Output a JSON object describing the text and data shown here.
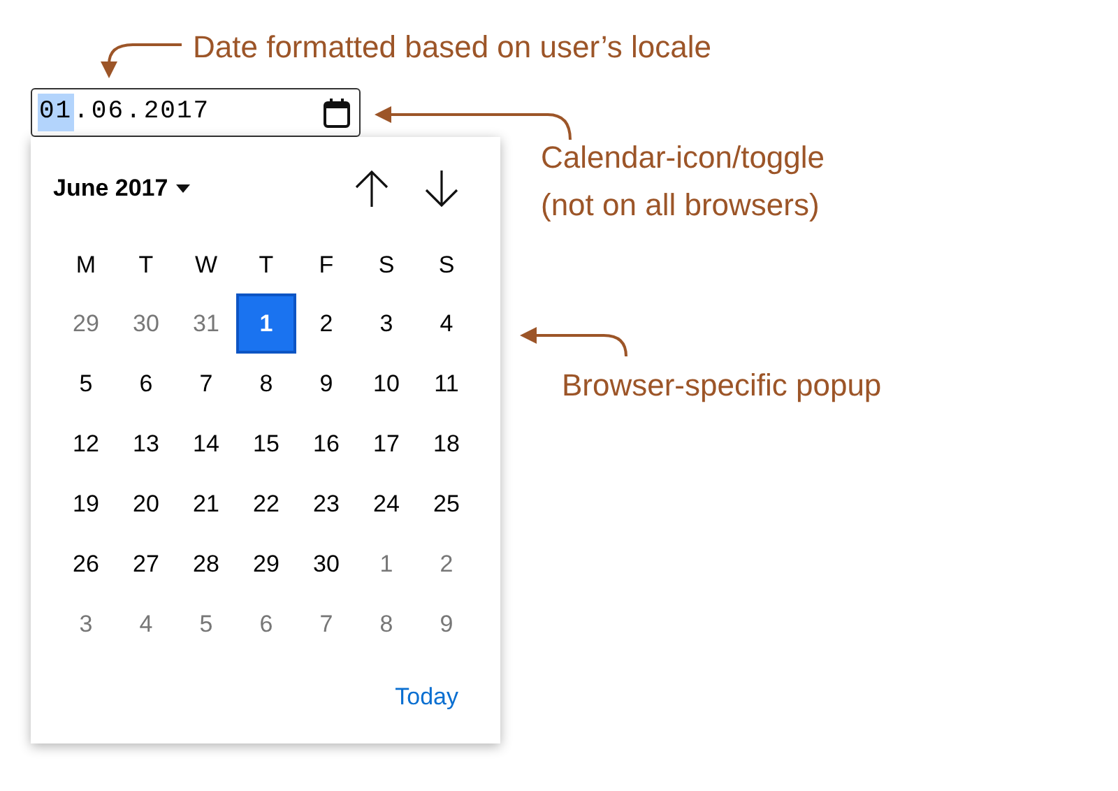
{
  "date_field": {
    "segments": [
      {
        "kind": "part",
        "text": "01",
        "selected": true
      },
      {
        "kind": "separator",
        "text": "."
      },
      {
        "kind": "part",
        "text": "06",
        "selected": false
      },
      {
        "kind": "separator",
        "text": "."
      },
      {
        "kind": "part",
        "text": "2017",
        "selected": false
      }
    ]
  },
  "calendar": {
    "title": "June 2017",
    "weekdays": [
      "M",
      "T",
      "W",
      "T",
      "F",
      "S",
      "S"
    ],
    "weeks": [
      [
        {
          "text": "29",
          "muted": true,
          "selected": false
        },
        {
          "text": "30",
          "muted": true,
          "selected": false
        },
        {
          "text": "31",
          "muted": true,
          "selected": false
        },
        {
          "text": "1",
          "muted": false,
          "selected": true
        },
        {
          "text": "2",
          "muted": false,
          "selected": false
        },
        {
          "text": "3",
          "muted": false,
          "selected": false
        },
        {
          "text": "4",
          "muted": false,
          "selected": false
        }
      ],
      [
        {
          "text": "5",
          "muted": false,
          "selected": false
        },
        {
          "text": "6",
          "muted": false,
          "selected": false
        },
        {
          "text": "7",
          "muted": false,
          "selected": false
        },
        {
          "text": "8",
          "muted": false,
          "selected": false
        },
        {
          "text": "9",
          "muted": false,
          "selected": false
        },
        {
          "text": "10",
          "muted": false,
          "selected": false
        },
        {
          "text": "11",
          "muted": false,
          "selected": false
        }
      ],
      [
        {
          "text": "12",
          "muted": false,
          "selected": false
        },
        {
          "text": "13",
          "muted": false,
          "selected": false
        },
        {
          "text": "14",
          "muted": false,
          "selected": false
        },
        {
          "text": "15",
          "muted": false,
          "selected": false
        },
        {
          "text": "16",
          "muted": false,
          "selected": false
        },
        {
          "text": "17",
          "muted": false,
          "selected": false
        },
        {
          "text": "18",
          "muted": false,
          "selected": false
        }
      ],
      [
        {
          "text": "19",
          "muted": false,
          "selected": false
        },
        {
          "text": "20",
          "muted": false,
          "selected": false
        },
        {
          "text": "21",
          "muted": false,
          "selected": false
        },
        {
          "text": "22",
          "muted": false,
          "selected": false
        },
        {
          "text": "23",
          "muted": false,
          "selected": false
        },
        {
          "text": "24",
          "muted": false,
          "selected": false
        },
        {
          "text": "25",
          "muted": false,
          "selected": false
        }
      ],
      [
        {
          "text": "26",
          "muted": false,
          "selected": false
        },
        {
          "text": "27",
          "muted": false,
          "selected": false
        },
        {
          "text": "28",
          "muted": false,
          "selected": false
        },
        {
          "text": "29",
          "muted": false,
          "selected": false
        },
        {
          "text": "30",
          "muted": false,
          "selected": false
        },
        {
          "text": "1",
          "muted": true,
          "selected": false
        },
        {
          "text": "2",
          "muted": true,
          "selected": false
        }
      ],
      [
        {
          "text": "3",
          "muted": true,
          "selected": false
        },
        {
          "text": "4",
          "muted": true,
          "selected": false
        },
        {
          "text": "5",
          "muted": true,
          "selected": false
        },
        {
          "text": "6",
          "muted": true,
          "selected": false
        },
        {
          "text": "7",
          "muted": true,
          "selected": false
        },
        {
          "text": "8",
          "muted": true,
          "selected": false
        },
        {
          "text": "9",
          "muted": true,
          "selected": false
        }
      ]
    ],
    "today_button": "Today"
  },
  "annotations": [
    {
      "lines": [
        "Date formatted based on user’s locale"
      ]
    },
    {
      "lines": [
        "Calendar-icon/toggle",
        "(not on all browsers)"
      ]
    },
    {
      "lines": [
        "Browser-specific popup"
      ]
    }
  ]
}
